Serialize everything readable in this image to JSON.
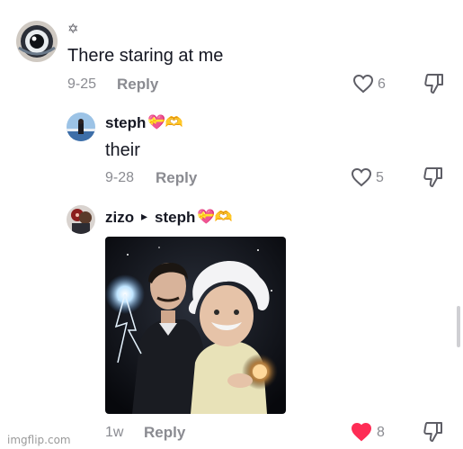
{
  "comments": [
    {
      "username_mark": "✡",
      "text": "There staring at me",
      "date": "9-25",
      "reply_label": "Reply",
      "likes": "6"
    },
    {
      "username": "steph",
      "emoji": "💝🫶",
      "text": "their",
      "date": "9-28",
      "reply_label": "Reply",
      "likes": "5"
    },
    {
      "username": "zizo",
      "reply_to_arrow": "▸",
      "reply_to": "steph",
      "emoji": "💝🫶",
      "date": "1w",
      "reply_label": "Reply",
      "likes": "8",
      "liked": true
    }
  ],
  "colors": {
    "liked_heart": "#fe2c55",
    "muted_text": "#8a8b91"
  },
  "watermark": "imgflip.com"
}
